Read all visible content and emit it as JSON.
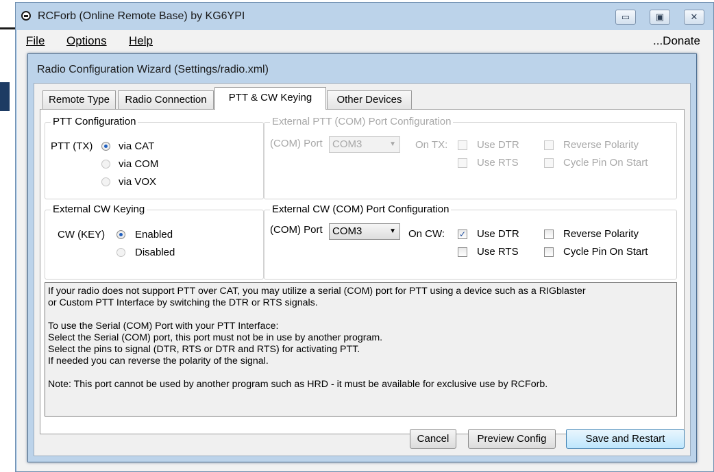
{
  "window": {
    "title": "RCForb (Online Remote Base) by KG6YPI",
    "minimize_glyph": "▭",
    "maximize_glyph": "▣",
    "close_glyph": "✕"
  },
  "menu": {
    "file": "File",
    "options": "Options",
    "help": "Help",
    "donate": "...Donate"
  },
  "dialog": {
    "title": "Radio Configuration Wizard (Settings/radio.xml)",
    "tabs": [
      "Remote Type",
      "Radio Connection",
      "PTT & CW Keying",
      "Other Devices"
    ],
    "ptt_config": {
      "title": "PTT Configuration",
      "label": "PTT (TX)",
      "options": [
        "via CAT",
        "via COM",
        "via VOX"
      ]
    },
    "ext_ptt": {
      "title": "External PTT (COM) Port Configuration",
      "com_label": "(COM) Port",
      "com_value": "COM3",
      "on_label": "On TX:",
      "use_dtr": "Use DTR",
      "use_rts": "Use RTS",
      "reverse": "Reverse Polarity",
      "cycle": "Cycle Pin On Start"
    },
    "ext_cw": {
      "title": "External CW Keying",
      "label": "CW (KEY)",
      "options": [
        "Enabled",
        "Disabled"
      ]
    },
    "ext_cw_port": {
      "title": "External CW (COM) Port Configuration",
      "com_label": "(COM) Port",
      "com_value": "COM3",
      "on_label": "On CW:",
      "use_dtr": "Use DTR",
      "use_rts": "Use RTS",
      "reverse": "Reverse Polarity",
      "cycle": "Cycle Pin On Start",
      "checked_mark": "✓"
    },
    "info_text": "If your radio does not support PTT over CAT, you may utilize a serial (COM) port for PTT using a device such as a RIGblaster\nor Custom PTT Interface by switching the DTR or RTS signals.\n\nTo use the Serial (COM) Port with your PTT Interface:\nSelect the Serial (COM) port, this port must not be in use by another program.\nSelect the pins to signal (DTR, RTS or DTR and RTS) for activating PTT.\nIf needed you can reverse the polarity of the signal.\n\nNote: This port cannot be used by another program such as HRD - it must be available for exclusive use by RCForb.",
    "buttons": {
      "cancel": "Cancel",
      "preview": "Preview Config",
      "save": "Save and Restart"
    },
    "dropdown_glyph": "▼"
  }
}
